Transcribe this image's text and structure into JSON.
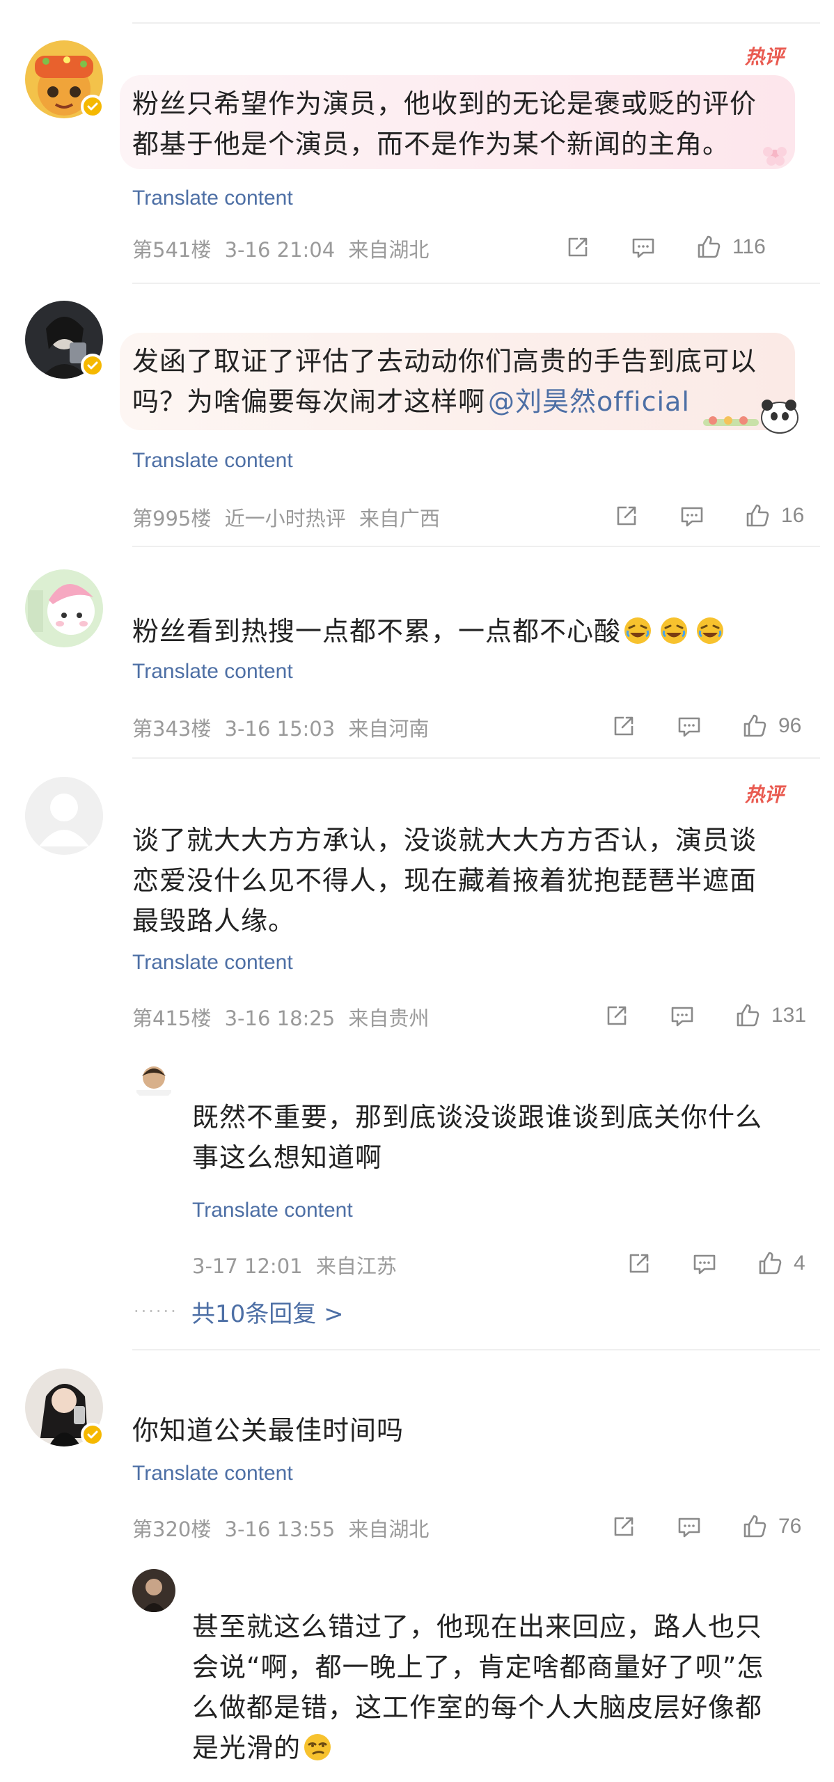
{
  "ui": {
    "translate_label": "Translate content",
    "hot_label": "热评"
  },
  "comments": [
    {
      "lines": [
        "粉丝只希望作为演员，他收到的无论是褒或贬的评价",
        "都基于他是个演员，而不是作为某个新闻的主角。"
      ],
      "floor": "第541楼",
      "time": "3-16 21:04",
      "location": "来自湖北",
      "likes": "116"
    },
    {
      "line1": "发函了取证了评估了去动动你们高贵的手告到底可以",
      "line2_prefix": "吗？为啥偏要每次闹才这样啊",
      "mention": "@刘昊然official",
      "floor": "第995楼",
      "time": "近一小时热评",
      "location": "来自广西",
      "likes": "16"
    },
    {
      "lines": [
        "粉丝看到热搜一点都不累，一点都不心酸"
      ],
      "floor": "第343楼",
      "time": "3-16 15:03",
      "location": "来自河南",
      "likes": "96"
    },
    {
      "lines": [
        "谈了就大大方方承认，没谈就大大方方否认，演员谈",
        "恋爱没什么见不得人，现在藏着掖着犹抱琵琶半遮面",
        "最毁路人缘。"
      ],
      "floor": "第415楼",
      "time": "3-16 18:25",
      "location": "来自贵州",
      "likes": "131",
      "reply": {
        "lines": [
          "既然不重要，那到底谈没谈跟谁谈到底关你什么",
          "事这么想知道啊"
        ],
        "time": "3-17 12:01",
        "location": "来自江苏",
        "likes": "4"
      },
      "more_replies": "共10条回复 >"
    },
    {
      "lines": [
        "你知道公关最佳时间吗"
      ],
      "floor": "第320楼",
      "time": "3-16 13:55",
      "location": "来自湖北",
      "likes": "76",
      "reply": {
        "lines": [
          "甚至就这么错过了，他现在出来回应，路人也只",
          "会说“啊，都一晚上了，肯定啥都商量好了呗”怎",
          "么做都是错，这工作室的每个人大脑皮层好像都",
          "是光滑的"
        ]
      }
    }
  ],
  "colors": {
    "link": "#4d6fa5",
    "meta": "#9a9a9a",
    "hot": "#e95a50",
    "badge": "#f5b800"
  },
  "icons": [
    "share-icon",
    "comment-icon",
    "like-icon",
    "verified-badge-icon",
    "rofl-emoji-icon",
    "smirk-emoji-icon"
  ]
}
